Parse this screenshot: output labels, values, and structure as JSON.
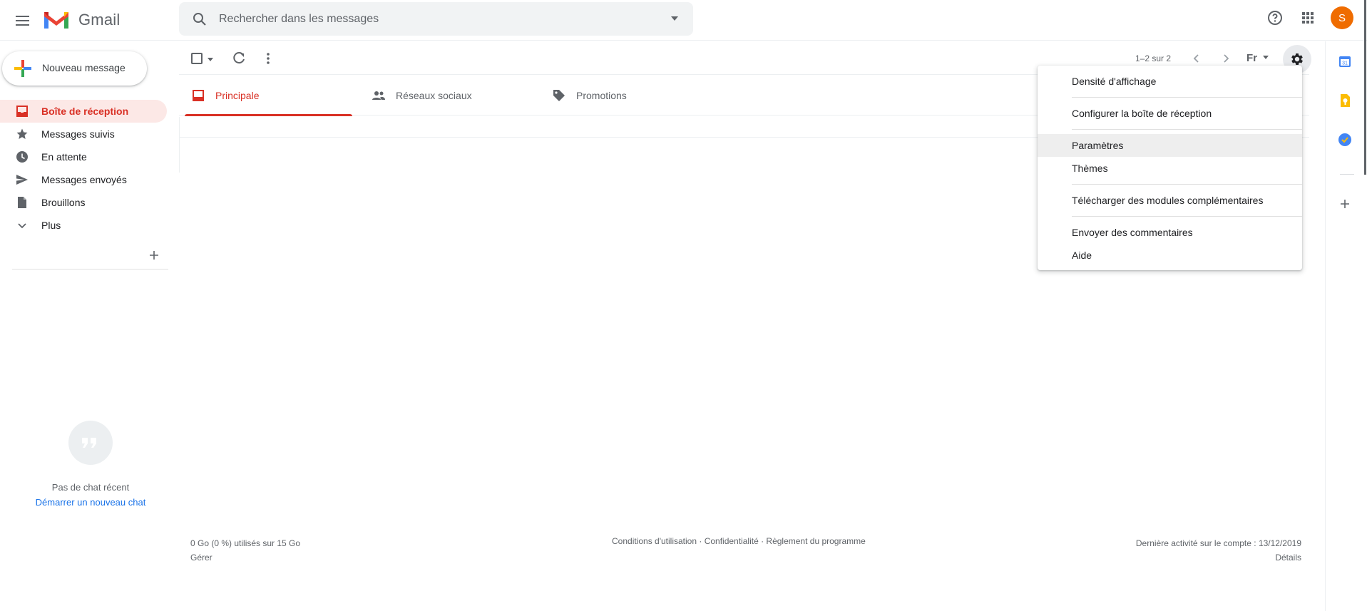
{
  "app": {
    "name": "Gmail"
  },
  "colors": {
    "accent": "#d93025",
    "active_bg": "#fce8e6",
    "avatar": "#ef6c00",
    "link": "#1a73e8"
  },
  "header": {
    "search_placeholder": "Rechercher dans les messages",
    "avatar_letter": "S",
    "icons": [
      "menu-icon",
      "gmail-logo",
      "search-icon",
      "search-options-icon",
      "help-icon",
      "apps-icon"
    ]
  },
  "sidebar": {
    "compose_label": "Nouveau message",
    "items": [
      {
        "label": "Boîte de réception",
        "icon": "inbox-icon",
        "active": true
      },
      {
        "label": "Messages suivis",
        "icon": "star-icon"
      },
      {
        "label": "En attente",
        "icon": "clock-icon"
      },
      {
        "label": "Messages envoyés",
        "icon": "send-icon"
      },
      {
        "label": "Brouillons",
        "icon": "draft-icon"
      },
      {
        "label": "Plus",
        "icon": "chevron-down-icon"
      }
    ]
  },
  "chat": {
    "empty_text": "Pas de chat récent",
    "start_link": "Démarrer un nouveau chat"
  },
  "toolbar": {
    "pagination": "1–2 sur 2",
    "lang": "Fr"
  },
  "tabs": [
    {
      "label": "Principale",
      "icon": "inbox-tab-icon",
      "active": true
    },
    {
      "label": "Réseaux sociaux",
      "icon": "people-icon"
    },
    {
      "label": "Promotions",
      "icon": "tag-icon"
    }
  ],
  "settings_menu": {
    "items": [
      "Densité d'affichage",
      "Configurer la boîte de réception",
      "Paramètres",
      "Thèmes",
      "Télécharger des modules complémentaires",
      "Envoyer des commentaires",
      "Aide"
    ],
    "hovered": "Paramètres"
  },
  "footer": {
    "storage": "0 Go (0 %) utilisés sur 15 Go",
    "manage": "Gérer",
    "links": "Conditions d'utilisation · Confidentialité · Règlement du programme",
    "last_activity": "Dernière activité sur le compte : 13/12/2019",
    "details": "Détails"
  }
}
